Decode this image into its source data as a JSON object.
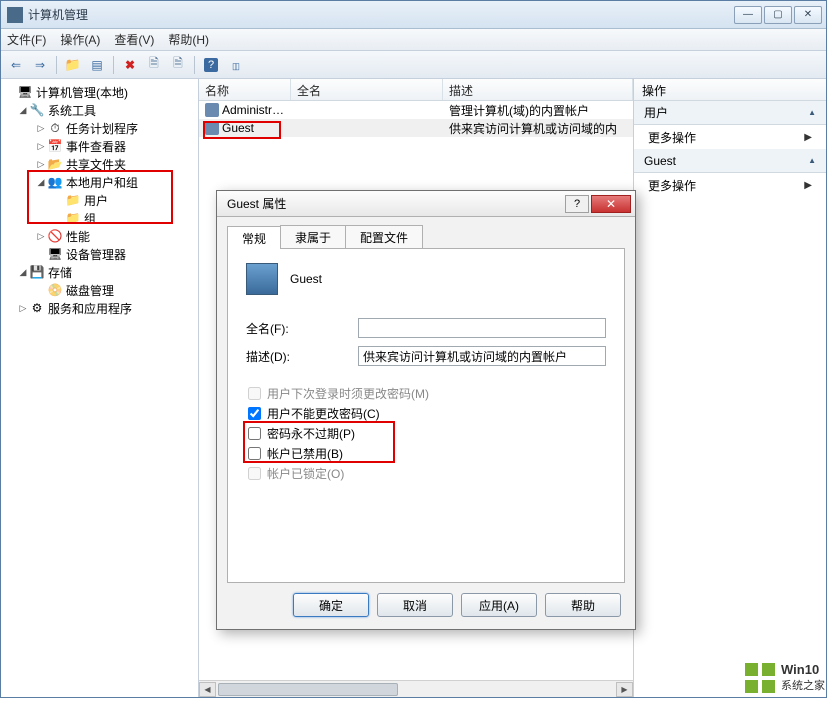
{
  "window": {
    "title": "计算机管理"
  },
  "menu": {
    "file": "文件(F)",
    "action": "操作(A)",
    "view": "查看(V)",
    "help": "帮助(H)"
  },
  "tree": {
    "root": "计算机管理(本地)",
    "sys_tools": "系统工具",
    "task_sched": "任务计划程序",
    "event_viewer": "事件查看器",
    "shared": "共享文件夹",
    "local_users": "本地用户和组",
    "users": "用户",
    "groups": "组",
    "perf": "性能",
    "devmgr": "设备管理器",
    "storage": "存储",
    "disk": "磁盘管理",
    "services": "服务和应用程序"
  },
  "list": {
    "col_name": "名称",
    "col_full": "全名",
    "col_desc": "描述",
    "rows": [
      {
        "name": "Administrat...",
        "full": "",
        "desc": "管理计算机(域)的内置帐户"
      },
      {
        "name": "Guest",
        "full": "",
        "desc": "供来宾访问计算机或访问域的内"
      }
    ]
  },
  "actions": {
    "header": "操作",
    "group1": "用户",
    "more1": "更多操作",
    "group2": "Guest",
    "more2": "更多操作"
  },
  "dialog": {
    "title": "Guest 属性",
    "tab_general": "常规",
    "tab_member": "隶属于",
    "tab_profile": "配置文件",
    "username": "Guest",
    "label_full": "全名(F):",
    "value_full": "",
    "label_desc": "描述(D):",
    "value_desc": "供来宾访问计算机或访问域的内置帐户",
    "chk_must_change": "用户下次登录时须更改密码(M)",
    "chk_cannot_change": "用户不能更改密码(C)",
    "chk_never_expire": "密码永不过期(P)",
    "chk_disabled": "帐户已禁用(B)",
    "chk_locked": "帐户已锁定(O)",
    "btn_ok": "确定",
    "btn_cancel": "取消",
    "btn_apply": "应用(A)",
    "btn_help": "帮助"
  },
  "watermark": {
    "line1": "Win10",
    "line2": "系统之家"
  }
}
